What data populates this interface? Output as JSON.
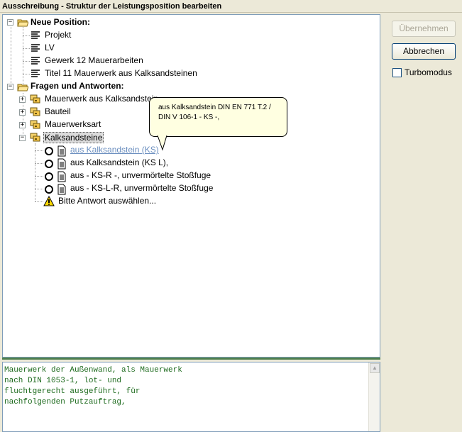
{
  "window": {
    "title": "Ausschreibung - Struktur der Leistungsposition bearbeiten"
  },
  "tree": {
    "new_position": {
      "label": "Neue Position:",
      "items": [
        "Projekt",
        "LV",
        "Gewerk 12 Mauerarbeiten",
        "Titel 11 Mauerwerk aus Kalksandsteinen"
      ]
    },
    "qa": {
      "label": "Fragen und Antworten:",
      "items": [
        "Mauerwerk aus Kalksandstein",
        "Bauteil",
        "Mauerwerksart",
        "Kalksandsteine"
      ],
      "answers": [
        "aus Kalksandstein (KS)",
        "aus Kalksandstein (KS L),",
        "aus - KS-R -, unvermörtelte Stoßfuge",
        "aus - KS-L-R, unvermörtelte Stoßfuge"
      ],
      "hint": "Bitte Antwort auswählen..."
    }
  },
  "tooltip": {
    "line1": "aus Kalksandstein DIN EN 771 T.2 /",
    "line2": "DIN V 106-1 - KS -,"
  },
  "text_pane": {
    "content": "Mauerwerk der Außenwand, als Mauerwerk\nnach DIN 1053-1, lot- und\nfluchtgerecht ausgeführt, für\nnachfolgenden Putzauftrag,"
  },
  "buttons": {
    "apply": "Übernehmen",
    "cancel": "Abbrechen"
  },
  "turbo": {
    "label": "Turbomodus",
    "checked": false
  },
  "colors": {
    "tree_border": "#7f9db9",
    "text_green": "#1e6b1e",
    "splitter": "#4e7f4e",
    "tooltip_bg": "#ffffe1"
  }
}
